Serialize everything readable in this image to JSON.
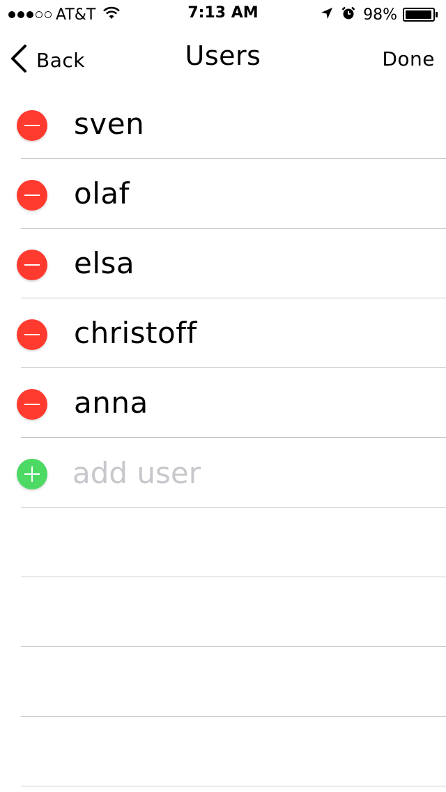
{
  "status_bar": {
    "signal_dots_filled": 3,
    "signal_dots_total": 5,
    "carrier": "AT&T",
    "time": "7:13 AM",
    "battery_percent": "98%",
    "battery_level": 0.98,
    "icons": [
      "wifi-icon",
      "location-arrow-icon",
      "alarm-clock-icon",
      "battery-icon"
    ]
  },
  "nav": {
    "back_label": "Back",
    "title": "Users",
    "done_label": "Done"
  },
  "users": [
    {
      "name": "sven"
    },
    {
      "name": "olaf"
    },
    {
      "name": "elsa"
    },
    {
      "name": "christoff"
    },
    {
      "name": "anna"
    }
  ],
  "add_user": {
    "placeholder": "add user",
    "value": ""
  },
  "colors": {
    "delete": "#ff3b30",
    "add": "#4cd964",
    "separator": "#c8c7cc",
    "placeholder": "#c7c7cc"
  }
}
